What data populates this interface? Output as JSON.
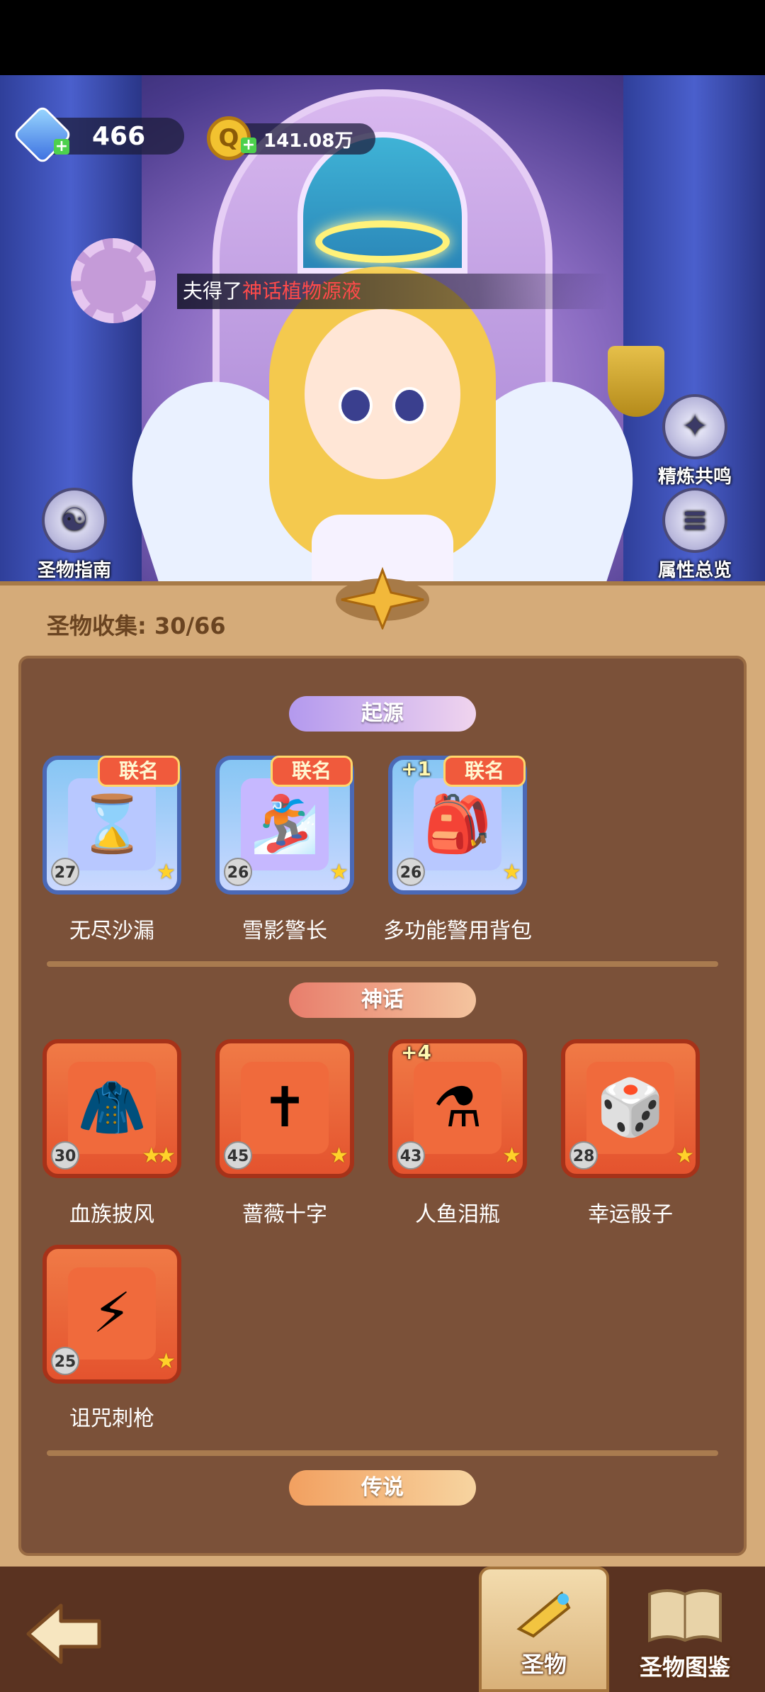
{
  "resources": {
    "gems": "466",
    "coins": "141.08万"
  },
  "notice": {
    "prefix": "夫得了",
    "highlight": "神话植物源液"
  },
  "side_buttons": {
    "guide": "圣物指南",
    "refine": "精炼共鸣",
    "attributes": "属性总览"
  },
  "panel": {
    "collection_text": "圣物收集: 30/66"
  },
  "sections": {
    "origin": {
      "title": "起源",
      "items": [
        {
          "name": "无尽沙漏",
          "level": "27",
          "badge": "联名",
          "plus": "",
          "stars": 1,
          "icon": "hourglass-icon"
        },
        {
          "name": "雪影警长",
          "level": "26",
          "badge": "联名",
          "plus": "",
          "stars": 1,
          "icon": "snowboard-sheriff-icon"
        },
        {
          "name": "多功能警用背包",
          "level": "26",
          "badge": "联名",
          "plus": "+1",
          "stars": 1,
          "icon": "backpack-icon"
        }
      ]
    },
    "myth": {
      "title": "神话",
      "items": [
        {
          "name": "血族披风",
          "level": "30",
          "plus": "",
          "stars": 2,
          "icon": "cape-icon"
        },
        {
          "name": "蔷薇十字",
          "level": "45",
          "plus": "",
          "stars": 1,
          "icon": "rose-cross-icon"
        },
        {
          "name": "人鱼泪瓶",
          "level": "43",
          "plus": "+4",
          "stars": 1,
          "icon": "potion-bottle-icon"
        },
        {
          "name": "幸运骰子",
          "level": "28",
          "plus": "",
          "stars": 1,
          "icon": "dice-icon"
        },
        {
          "name": "诅咒刺枪",
          "level": "25",
          "plus": "",
          "stars": 1,
          "icon": "spear-icon"
        }
      ]
    },
    "legend": {
      "title": "传说"
    }
  },
  "bottom_tabs": {
    "relic": "圣物",
    "codex": "圣物图鉴"
  },
  "colors": {
    "panel_bg": "#d5ab79",
    "inner_bg": "#7b5139",
    "origin_card": "#86c6f4",
    "myth_card": "#e4532e",
    "notice_highlight": "#ff4a4a"
  }
}
